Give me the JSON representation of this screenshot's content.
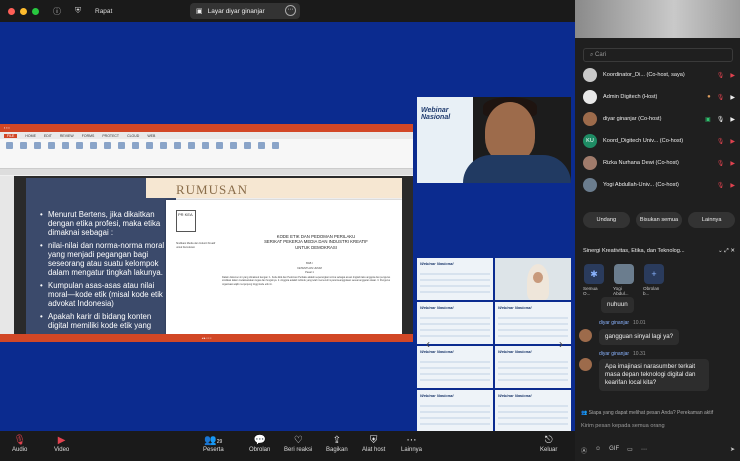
{
  "titlebar": {
    "meeting_label": "Rapat",
    "share_tab": "Layar diyar ginanjar",
    "colors": [
      "#ff5f57",
      "#febc2e",
      "#28c840"
    ]
  },
  "slide": {
    "title": "RUMUSAN",
    "bullets": [
      "Menurut Bertens, jika dikaitkan dengan etika profesi, maka etika dimaknai sebagai :",
      "nilai-nilai dan norma-norma moral yang menjadi pegangan bagi seseorang atau suatu kelompok dalam mengatur tingkah lakunya.",
      "Kumpulan asas-asas atau nilai moral—kode etik (misal kode etik advokat Indonesia)",
      "Apakah karir di bidang konten digital memiliki kode etik yang"
    ],
    "logo_text": "PR KEA",
    "doc_title_1": "KODE ETIK DAN PEDOMAN PERILAKU",
    "doc_title_2": "SERIKAT PEKERJA MEDIA DAN INDUSTRI KREATIF",
    "doc_title_3": "UNTUK DEMOKRASI",
    "side_text": "Sindikasi Media dan Industri Kreatif untuk Demokrasi",
    "bab": "BAB I",
    "bab_sub": "KETENTUAN UMUM",
    "pasal": "Pasal 1",
    "body": "Dalam dokumen ini yang dimaksud dengan: 1. Kode Etik dan Pedoman Perilaku adalah seperangkat norma sebagai acuan tingkah laku anggota dan pengurus sindikasi dalam melaksanakan tugas dan fungsinya. 2. Anggota adalah individu yang telah memenuhi syarat keanggotaan sesuai anggaran dasar. 3. Pengurus organisasi wajib menjunjung tinggi kode etik ini."
  },
  "gallery": {
    "tile_label": "Webinar Nasional"
  },
  "toolbar": {
    "audio": "Audio",
    "video": "Video",
    "peserta": "Peserta",
    "peserta_count": "29",
    "obrolan": "Obrolan",
    "beri_reaksi": "Beri reaksi",
    "bagikan": "Bagikan",
    "alat_host": "Alat host",
    "lainnya": "Lainnya",
    "keluar": "Keluar"
  },
  "participants": {
    "search_placeholder": "Cari",
    "list": [
      {
        "name": "Koordinator_Di... (Co-host, saya)",
        "initials": ""
      },
      {
        "name": "Admin Digitech (Host)",
        "initials": ""
      },
      {
        "name": "diyar ginanjar (Co-host)",
        "initials": ""
      },
      {
        "name": "Koord_Digitech Univ... (Co-host)",
        "initials": "KU"
      },
      {
        "name": "Rizka Nurhana Dewi (Co-host)",
        "initials": ""
      },
      {
        "name": "Yogi Abdullah-Univ... (Co-host)",
        "initials": ""
      }
    ],
    "btn_undang": "Undang",
    "btn_bisukan": "Bisukan semua",
    "btn_lainnya": "Lainnya"
  },
  "chat": {
    "title": "Sinergi Kreativitas, Etika, dan Teknolog...",
    "tags": [
      "Semua O...",
      "Yogi Abdul...",
      "Obrolan b..."
    ],
    "msg1_text": "nuhuun",
    "msg2_name": "diyar ginanjar",
    "msg2_time": "10.01",
    "msg2_text": "gangguan sinyal lagi ya?",
    "msg3_name": "diyar ginanjar",
    "msg3_time": "10.31",
    "msg3_text": "Apa imajinasi narasumber terkait masa depan teknologi digital dan kearifan local kita?",
    "privacy": "Siapa yang dapat melihat pesan Anda? Perekaman aktif",
    "input_placeholder": "Kirim pesan kepada semua orang",
    "gif": "GIF"
  }
}
